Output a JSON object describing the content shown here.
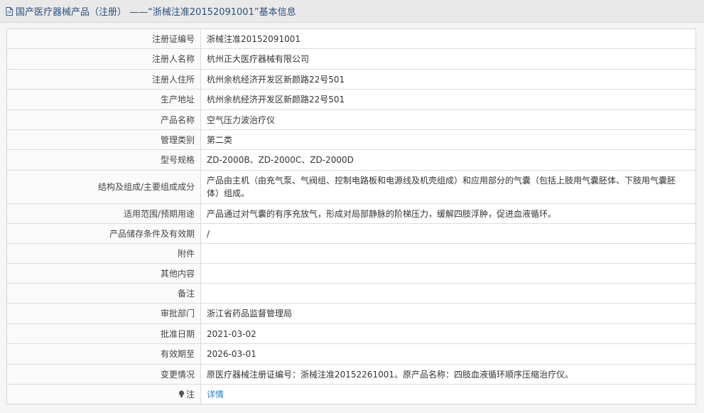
{
  "header": {
    "title": "国产医疗器械产品（注册） ——“浙械注准20152091001”基本信息"
  },
  "rows": [
    {
      "label": "注册证编号",
      "value": "浙械注准20152091001"
    },
    {
      "label": "注册人名称",
      "value": "杭州正大医疗器械有限公司"
    },
    {
      "label": "注册人住所",
      "value": "杭州余杭经济开发区新颜路22号501"
    },
    {
      "label": "生产地址",
      "value": "杭州余杭经济开发区新颜路22号501"
    },
    {
      "label": "产品名称",
      "value": "空气压力波治疗仪"
    },
    {
      "label": "管理类别",
      "value": "第二类"
    },
    {
      "label": "型号规格",
      "value": "ZD-2000B、ZD-2000C、ZD-2000D"
    },
    {
      "label": "结构及组成/主要组成成分",
      "value": "产品由主机（由充气泵、气阀组、控制电路板和电源线及机壳组成）和应用部分的气囊（包括上肢用气囊胚体、下肢用气囊胚体）组成。"
    },
    {
      "label": "适用范围/预期用途",
      "value": "产品通过对气囊的有序充放气，形成对局部静脉的阶梯压力，缓解四肢浮肿，促进血液循环。"
    },
    {
      "label": "产品储存条件及有效期",
      "value": "/"
    },
    {
      "label": "附件",
      "value": ""
    },
    {
      "label": "其他内容",
      "value": ""
    },
    {
      "label": "备注",
      "value": ""
    },
    {
      "label": "审批部门",
      "value": "浙江省药品监督管理局"
    },
    {
      "label": "批准日期",
      "value": "2021-03-02"
    },
    {
      "label": "有效期至",
      "value": "2026-03-01"
    },
    {
      "label": "变更情况",
      "value": "原医疗器械注册证编号：浙械注准20152261001。原产品名称：四肢血液循环顺序压缩治疗仪。"
    },
    {
      "label": "注",
      "value": "详情"
    }
  ]
}
